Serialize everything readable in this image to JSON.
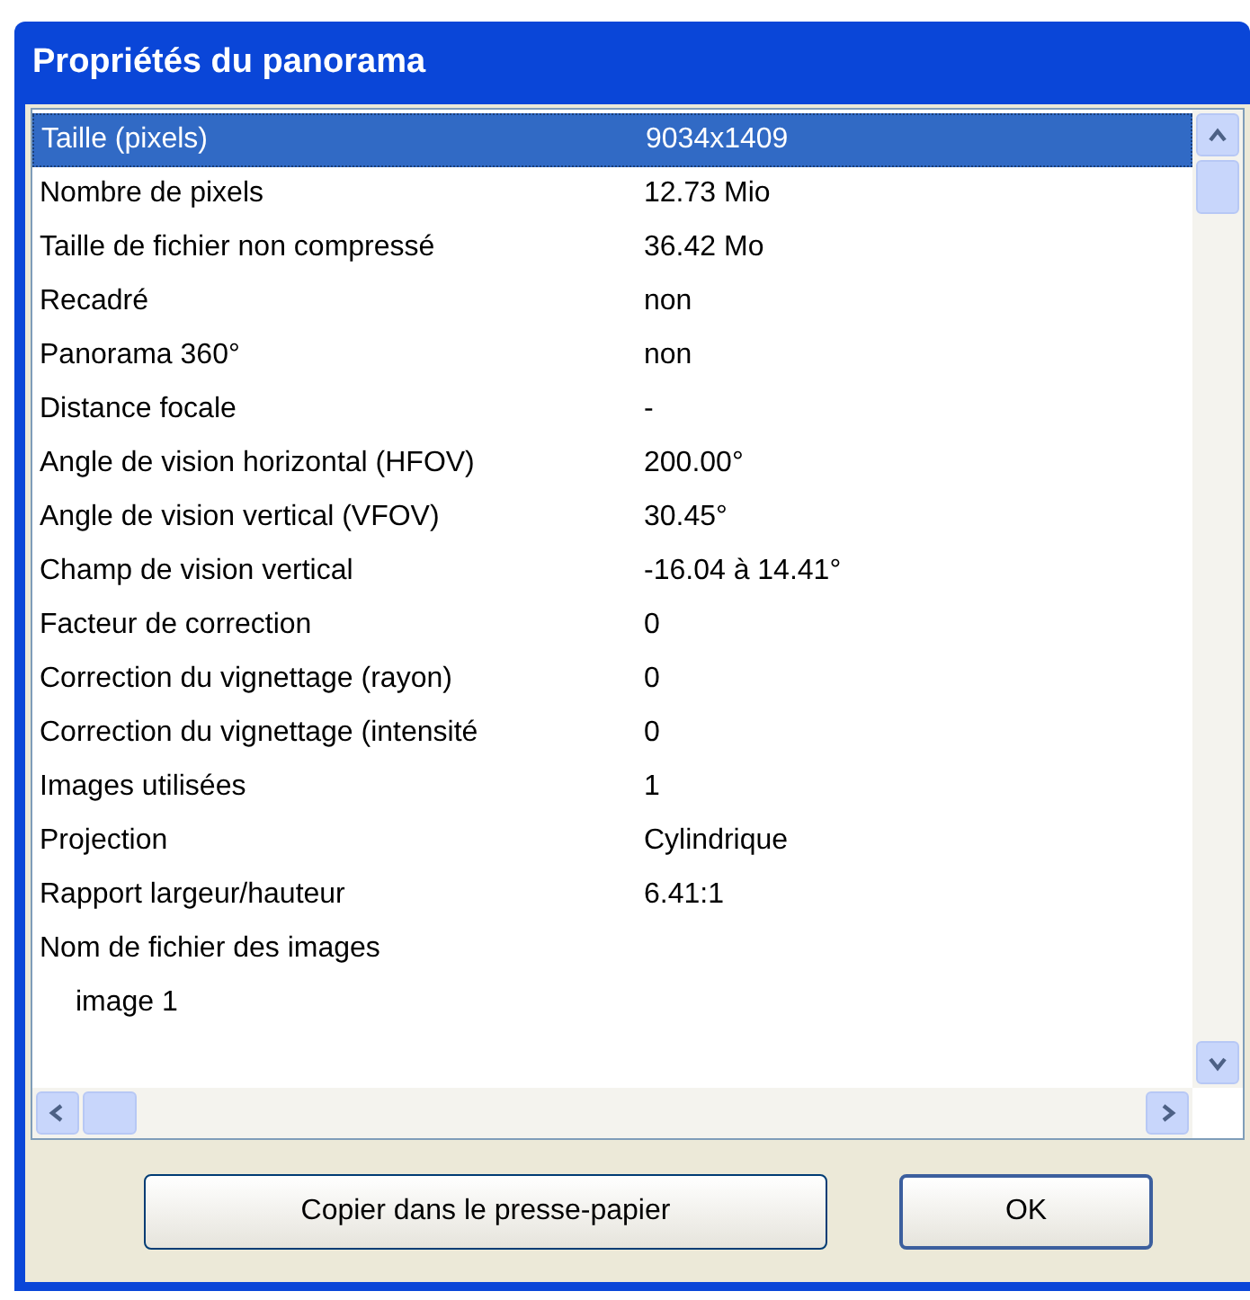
{
  "window": {
    "title": "Propriétés du panorama"
  },
  "rows": [
    {
      "name": "Taille (pixels)",
      "value": "9034x1409",
      "selected": true
    },
    {
      "name": "Nombre de pixels",
      "value": "12.73 Mio",
      "selected": false
    },
    {
      "name": "Taille de fichier non compressé",
      "value": "36.42 Mo",
      "selected": false
    },
    {
      "name": "Recadré",
      "value": "non",
      "selected": false
    },
    {
      "name": "Panorama 360°",
      "value": "non",
      "selected": false
    },
    {
      "name": "Distance focale",
      "value": "-",
      "selected": false
    },
    {
      "name": "Angle de vision horizontal (HFOV)",
      "value": "200.00°",
      "selected": false
    },
    {
      "name": "Angle de vision vertical (VFOV)",
      "value": "30.45°",
      "selected": false
    },
    {
      "name": "Champ de vision vertical",
      "value": "-16.04 à 14.41°",
      "selected": false
    },
    {
      "name": "Facteur de correction",
      "value": "0",
      "selected": false
    },
    {
      "name": "Correction du vignettage (rayon)",
      "value": "0",
      "selected": false
    },
    {
      "name": "Correction du vignettage (intensité",
      "value": "0",
      "selected": false
    },
    {
      "name": "Images utilisées",
      "value": "1",
      "selected": false
    },
    {
      "name": "Projection",
      "value": "Cylindrique",
      "selected": false
    },
    {
      "name": "Rapport largeur/hauteur",
      "value": "6.41:1",
      "selected": false
    },
    {
      "name": "Nom de fichier des images",
      "selected": false,
      "children": [
        {
          "name": "image 1",
          "selected": false
        }
      ]
    }
  ],
  "buttons": [
    {
      "label": "Copier dans le presse-papier",
      "default": false
    },
    {
      "label": "OK",
      "default": true
    }
  ]
}
